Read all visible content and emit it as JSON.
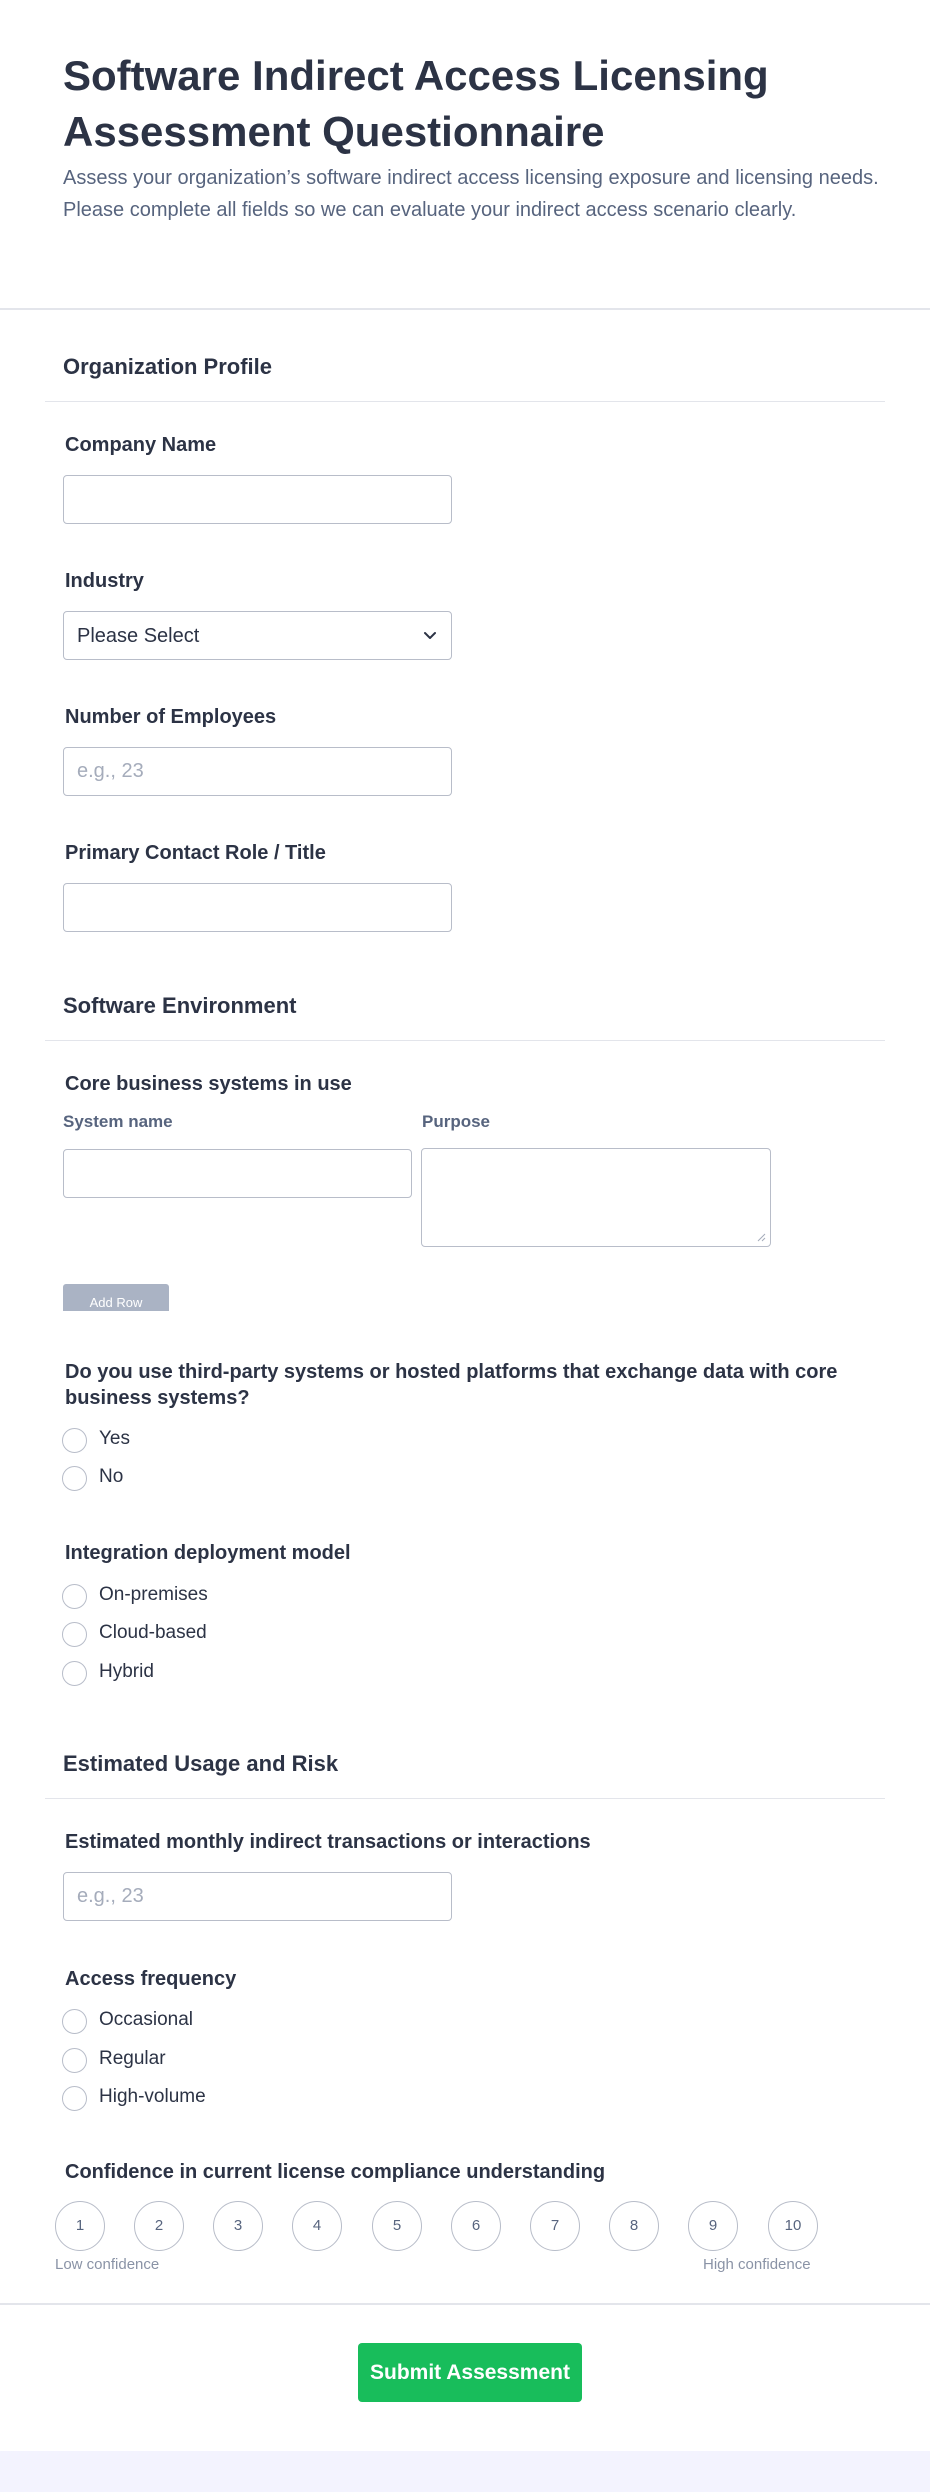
{
  "header": {
    "title": "Software Indirect Access Licensing Assessment Questionnaire",
    "subtitle": "Assess your organization’s software indirect access licensing exposure and licensing needs. Please complete all fields so we can evaluate your indirect access scenario clearly."
  },
  "organization_profile": {
    "heading": "Organization Profile",
    "company_name": {
      "label": "Company Name",
      "value": ""
    },
    "industry": {
      "label": "Industry",
      "selected": "Please Select"
    },
    "employees": {
      "label": "Number of Employees",
      "placeholder": "e.g., 23"
    },
    "contact_role": {
      "label": "Primary Contact Role / Title",
      "value": ""
    }
  },
  "software_environment": {
    "heading": "Software Environment",
    "core_systems": {
      "label": "Core business systems in use",
      "col_system": "System name",
      "col_purpose": "Purpose",
      "add_row": "Add Row"
    },
    "third_party": {
      "label": "Do you use third-party systems or hosted platforms that exchange data with core business systems?",
      "options": [
        "Yes",
        "No"
      ]
    },
    "deployment": {
      "label": "Integration deployment model",
      "options": [
        "On-premises",
        "Cloud-based",
        "Hybrid"
      ]
    }
  },
  "usage_risk": {
    "heading": "Estimated Usage and Risk",
    "monthly_transactions": {
      "label": "Estimated monthly indirect transactions or interactions",
      "placeholder": "e.g., 23"
    },
    "frequency": {
      "label": "Access frequency",
      "options": [
        "Occasional",
        "Regular",
        "High-volume"
      ]
    },
    "confidence": {
      "label": "Confidence in current license compliance understanding",
      "scale": [
        "1",
        "2",
        "3",
        "4",
        "5",
        "6",
        "7",
        "8",
        "9",
        "10"
      ],
      "low_caption": "Low confidence",
      "high_caption": "High confidence"
    }
  },
  "submit_label": "Submit Assessment"
}
